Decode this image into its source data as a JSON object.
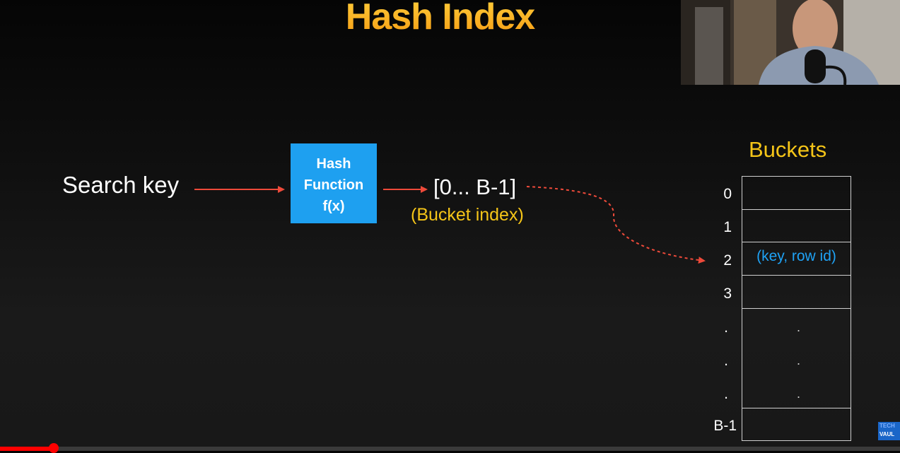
{
  "title": "Hash Index",
  "search_key": "Search key",
  "hash_function": {
    "line1": "Hash",
    "line2": "Function",
    "line3": "f(x)"
  },
  "range": "[0... B-1]",
  "bucket_index_label": "(Bucket index)",
  "buckets": {
    "title": "Buckets",
    "labels": [
      "0",
      "1",
      "2",
      "3",
      ".",
      ".",
      ".",
      "B-1"
    ],
    "entry": "(key, row id)"
  },
  "logo": {
    "line1": "TECH",
    "line2": "VAUL"
  },
  "video_progress": 0.06,
  "colors": {
    "title": "#f5a516",
    "hash_box": "#1ea0f0",
    "arrow": "#ee4a3a",
    "yellow_text": "#f5c518",
    "entry_text": "#1fa2f5"
  }
}
